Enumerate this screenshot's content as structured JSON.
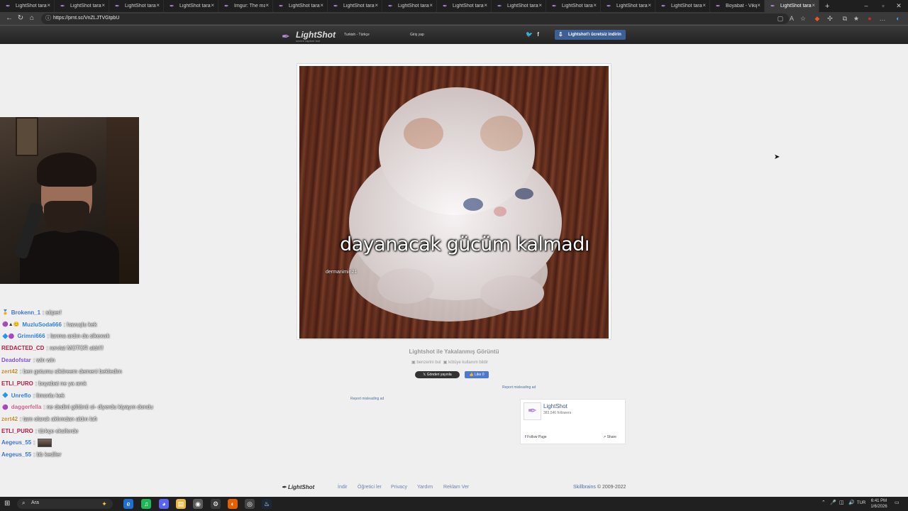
{
  "browser": {
    "tabs": [
      {
        "label": "LightShot tarafın",
        "active": false
      },
      {
        "label": "LightShot tarafın",
        "active": false
      },
      {
        "label": "LightShot tarafın",
        "active": false
      },
      {
        "label": "LightShot tarafın",
        "active": false
      },
      {
        "label": "Imgur: The magi",
        "active": false
      },
      {
        "label": "LightShot tarafın",
        "active": false
      },
      {
        "label": "LightShot tarafın",
        "active": false
      },
      {
        "label": "LightShot tarafın",
        "active": false
      },
      {
        "label": "LightShot tarafın",
        "active": false
      },
      {
        "label": "LightShot tarafın",
        "active": false
      },
      {
        "label": "LightShot tarafın",
        "active": false
      },
      {
        "label": "LightShot tarafın",
        "active": false
      },
      {
        "label": "LightShot tarafın",
        "active": false
      },
      {
        "label": "Boyabat - Vikipe",
        "active": false
      },
      {
        "label": "LightShot tarafın",
        "active": true
      }
    ],
    "url": "https://prnt.sc/VnZLJTVGtpbU"
  },
  "header": {
    "logo_name": "LightShot",
    "logo_tagline": "screen capture tool",
    "language": "Turkish - Türkçe",
    "login": "Giriş yap",
    "social_icons": "twitter-icon, facebook-icon",
    "download_label": "Lightshot'ı ücretsiz indirin"
  },
  "screenshot": {
    "caption": "dayanacak gücüm kalmadı",
    "watermark": "dermanimin21",
    "title": "Lightshot ile Yakalanmış Görüntü",
    "similar_label": "benzerini bul",
    "report_label": "kötüye kullanım bildir",
    "tweet_label": "Gönderi yayınla",
    "like_label": "Like 0",
    "report_ad": "Report misleading ad"
  },
  "facebook": {
    "name": "LightShot",
    "followers": "383,546 followers",
    "follow_label": "Follow Page",
    "share_label": "Share"
  },
  "footer": {
    "logo": "LightShot",
    "links": [
      "İndir",
      "Öğretici ler",
      "Privacy",
      "Yardım",
      "Reklam Ver"
    ],
    "brand": "Skillbrains",
    "copyright": "© 2009-2022"
  },
  "chat": [
    {
      "badges": "🏅",
      "user": "Brokenn_1",
      "color": "#3b6fd6",
      "msg": ": süper!"
    },
    {
      "badges": "🟣▲😊",
      "user": "MuzluSoda666",
      "color": "#2d7be0",
      "msg": ": havuçlu kek"
    },
    {
      "badges": "🔷🟣",
      "user": "Grimni666",
      "color": "#2d7be0",
      "msg": ": lanma ardın da sikexwk"
    },
    {
      "badges": "",
      "user": "REDACTED_CD",
      "color": "#c0143c",
      "msg": ": rerviat MOTOR aldı!!!"
    },
    {
      "badges": "",
      "user": "Deadofstar",
      "color": "#7b4fd6",
      "msg": ": win win"
    },
    {
      "badges": "",
      "user": "zert42",
      "color": "#c88a2a",
      "msg": ": ben gotumu siktireem demeni bekledim"
    },
    {
      "badges": "",
      "user": "ETLI_PURO",
      "color": "#c0143c",
      "msg": ": boyabat ne ya amk"
    },
    {
      "badges": "🔷",
      "user": "Unreflo",
      "color": "#2d7be0",
      "msg": ": limonlu kek"
    },
    {
      "badges": "🟣",
      "user": "daggerfella",
      "color": "#d0608a",
      "msg": ": ne dedini götünü si- diyerdu kiyayın dondu"
    },
    {
      "badges": "",
      "user": "zert42",
      "color": "#c88a2a",
      "msg": ": tam olarak aklımdan aldın lafı"
    },
    {
      "badges": "",
      "user": "ETLI_PURO",
      "color": "#c0143c",
      "msg": ": türkçe eksilerde"
    },
    {
      "badges": "",
      "user": "Aegeus_55",
      "color": "#3b6fd6",
      "msg": ":",
      "emote": true
    },
    {
      "badges": "",
      "user": "Aegeus_55",
      "color": "#3b6fd6",
      "msg": ": bb kediler"
    }
  ],
  "taskbar": {
    "search_placeholder": "Ara",
    "language": "TUR",
    "time": "6:41 PM",
    "date": "1/6/2026"
  },
  "colors": {
    "accent": "#b58de0",
    "download_button": "#3e5f96",
    "like_button": "#4d78cf"
  }
}
